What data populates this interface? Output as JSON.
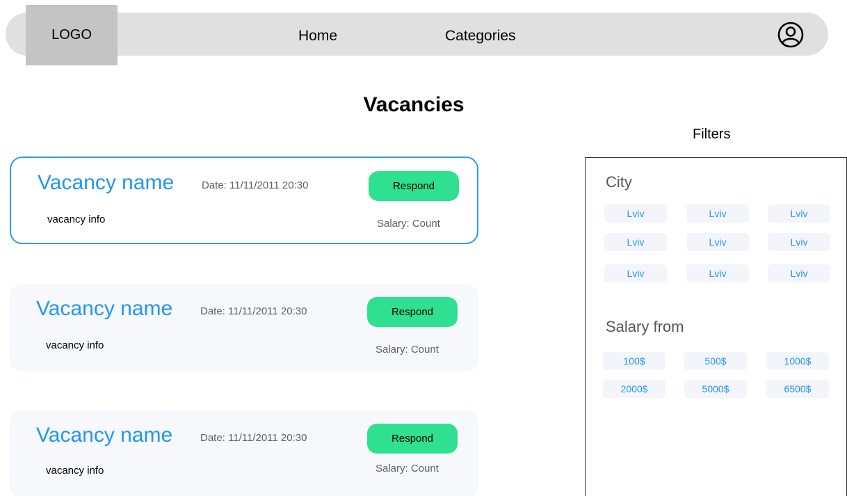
{
  "header": {
    "logo": "LOGO",
    "nav": [
      {
        "label": "Home"
      },
      {
        "label": "Categories"
      }
    ]
  },
  "page_title": "Vacancies",
  "vacancies": [
    {
      "name": "Vacancy name",
      "date": "Date: 11/11/2011 20:30",
      "button": "Respond",
      "info": "vacancy info",
      "salary": "Salary: Count",
      "selected": true
    },
    {
      "name": "Vacancy name",
      "date": "Date: 11/11/2011 20:30",
      "button": "Respond",
      "info": "vacancy info",
      "salary": "Salary: Count",
      "selected": false
    },
    {
      "name": "Vacancy name",
      "date": "Date: 11/11/2011 20:30",
      "button": "Respond",
      "info": "vacancy info",
      "salary": "Salary: Count",
      "selected": false
    }
  ],
  "filters": {
    "title": "Filters",
    "city": {
      "label": "City",
      "options": [
        "Lviv",
        "Lviv",
        "Lviv",
        "Lviv",
        "Lviv",
        "Lviv",
        "Lviv",
        "Lviv",
        "Lviv"
      ]
    },
    "salary": {
      "label": "Salary from",
      "options": [
        "100$",
        "500$",
        "1000$",
        "2000$",
        "5000$",
        "6500$"
      ]
    }
  },
  "colors": {
    "accent": "#2196f3",
    "respond": "#2ee08f",
    "navbar": "#e0e0e0",
    "logo_bg": "#c4c4c4"
  },
  "icons": {
    "user": "user-icon"
  }
}
